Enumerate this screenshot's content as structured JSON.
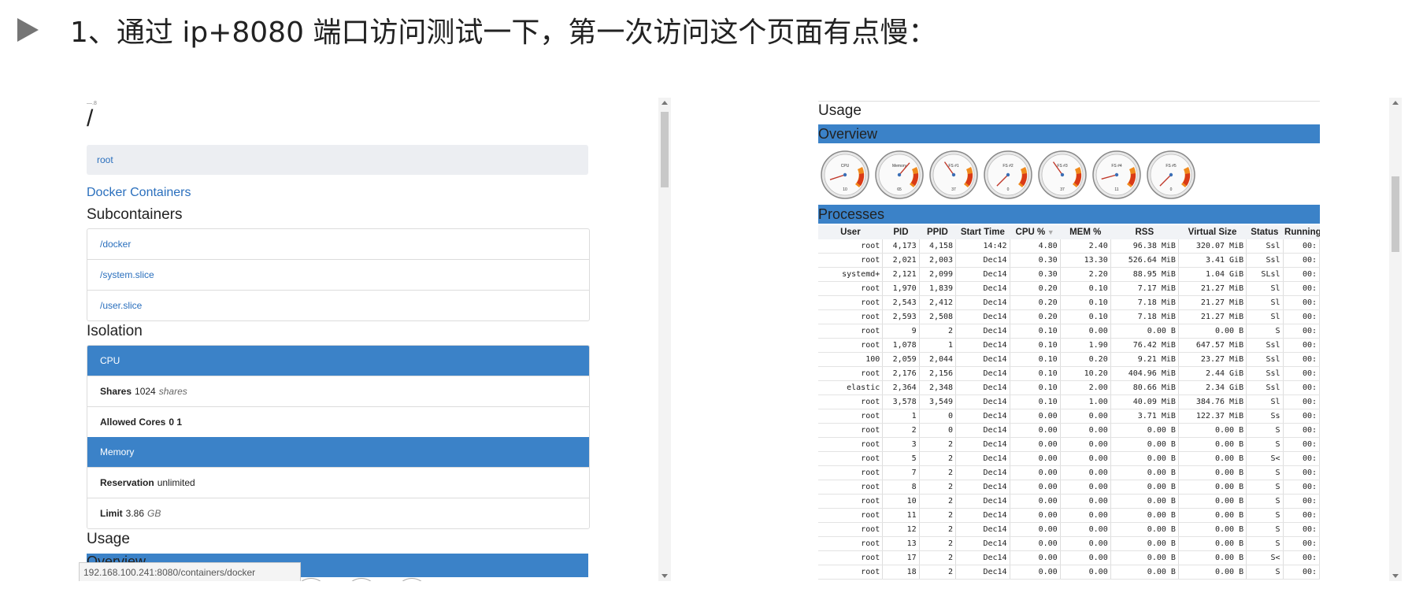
{
  "heading": "1、通过 ip+8080 端口访问测试一下，第一次访问这个页面有点慢：",
  "left": {
    "crumb_small": "—.8",
    "title": "/",
    "root_link": "root",
    "docker_link": "Docker Containers",
    "subcontainers_title": "Subcontainers",
    "subcontainers": [
      "/docker",
      "/system.slice",
      "/user.slice"
    ],
    "isolation_title": "Isolation",
    "cpu_header": "CPU",
    "shares_label": "Shares",
    "shares_value": "1024",
    "shares_unit": "shares",
    "cores_label": "Allowed Cores",
    "cores_value": "0 1",
    "memory_header": "Memory",
    "reservation_label": "Reservation",
    "reservation_value": "unlimited",
    "limit_label": "Limit",
    "limit_value": "3.86",
    "limit_unit": "GB",
    "usage_title": "Usage",
    "overview_title": "Overview",
    "status_url": "192.168.100.241:8080/containers/docker"
  },
  "right": {
    "usage_title": "Usage",
    "overview_title": "Overview",
    "gauges": [
      {
        "label": "CPU",
        "value": "10"
      },
      {
        "label": "Memory",
        "value": "65"
      },
      {
        "label": "FS #1",
        "value": "37"
      },
      {
        "label": "FS #2",
        "value": "0"
      },
      {
        "label": "FS #3",
        "value": "37"
      },
      {
        "label": "FS #4",
        "value": "11"
      },
      {
        "label": "FS #5",
        "value": "0"
      }
    ],
    "processes_title": "Processes",
    "columns": [
      "User",
      "PID",
      "PPID",
      "Start Time",
      "CPU %",
      "MEM %",
      "RSS",
      "Virtual Size",
      "Status",
      "Running"
    ],
    "rows": [
      [
        "root",
        "4,173",
        "4,158",
        "14:42",
        "4.80",
        "2.40",
        "96.38 MiB",
        "320.07 MiB",
        "Ssl",
        "00:"
      ],
      [
        "root",
        "2,021",
        "2,003",
        "Dec14",
        "0.30",
        "13.30",
        "526.64 MiB",
        "3.41 GiB",
        "Ssl",
        "00:"
      ],
      [
        "systemd+",
        "2,121",
        "2,099",
        "Dec14",
        "0.30",
        "2.20",
        "88.95 MiB",
        "1.04 GiB",
        "SLsl",
        "00:"
      ],
      [
        "root",
        "1,970",
        "1,839",
        "Dec14",
        "0.20",
        "0.10",
        "7.17 MiB",
        "21.27 MiB",
        "Sl",
        "00:"
      ],
      [
        "root",
        "2,543",
        "2,412",
        "Dec14",
        "0.20",
        "0.10",
        "7.18 MiB",
        "21.27 MiB",
        "Sl",
        "00:"
      ],
      [
        "root",
        "2,593",
        "2,508",
        "Dec14",
        "0.20",
        "0.10",
        "7.18 MiB",
        "21.27 MiB",
        "Sl",
        "00:"
      ],
      [
        "root",
        "9",
        "2",
        "Dec14",
        "0.10",
        "0.00",
        "0.00 B",
        "0.00 B",
        "S",
        "00:"
      ],
      [
        "root",
        "1,078",
        "1",
        "Dec14",
        "0.10",
        "1.90",
        "76.42 MiB",
        "647.57 MiB",
        "Ssl",
        "00:"
      ],
      [
        "100",
        "2,059",
        "2,044",
        "Dec14",
        "0.10",
        "0.20",
        "9.21 MiB",
        "23.27 MiB",
        "Ssl",
        "00:"
      ],
      [
        "root",
        "2,176",
        "2,156",
        "Dec14",
        "0.10",
        "10.20",
        "404.96 MiB",
        "2.44 GiB",
        "Ssl",
        "00:"
      ],
      [
        "elastic",
        "2,364",
        "2,348",
        "Dec14",
        "0.10",
        "2.00",
        "80.66 MiB",
        "2.34 GiB",
        "Ssl",
        "00:"
      ],
      [
        "root",
        "3,578",
        "3,549",
        "Dec14",
        "0.10",
        "1.00",
        "40.09 MiB",
        "384.76 MiB",
        "Sl",
        "00:"
      ],
      [
        "root",
        "1",
        "0",
        "Dec14",
        "0.00",
        "0.00",
        "3.71 MiB",
        "122.37 MiB",
        "Ss",
        "00:"
      ],
      [
        "root",
        "2",
        "0",
        "Dec14",
        "0.00",
        "0.00",
        "0.00 B",
        "0.00 B",
        "S",
        "00:"
      ],
      [
        "root",
        "3",
        "2",
        "Dec14",
        "0.00",
        "0.00",
        "0.00 B",
        "0.00 B",
        "S",
        "00:"
      ],
      [
        "root",
        "5",
        "2",
        "Dec14",
        "0.00",
        "0.00",
        "0.00 B",
        "0.00 B",
        "S<",
        "00:"
      ],
      [
        "root",
        "7",
        "2",
        "Dec14",
        "0.00",
        "0.00",
        "0.00 B",
        "0.00 B",
        "S",
        "00:"
      ],
      [
        "root",
        "8",
        "2",
        "Dec14",
        "0.00",
        "0.00",
        "0.00 B",
        "0.00 B",
        "S",
        "00:"
      ],
      [
        "root",
        "10",
        "2",
        "Dec14",
        "0.00",
        "0.00",
        "0.00 B",
        "0.00 B",
        "S",
        "00:"
      ],
      [
        "root",
        "11",
        "2",
        "Dec14",
        "0.00",
        "0.00",
        "0.00 B",
        "0.00 B",
        "S",
        "00:"
      ],
      [
        "root",
        "12",
        "2",
        "Dec14",
        "0.00",
        "0.00",
        "0.00 B",
        "0.00 B",
        "S",
        "00:"
      ],
      [
        "root",
        "13",
        "2",
        "Dec14",
        "0.00",
        "0.00",
        "0.00 B",
        "0.00 B",
        "S",
        "00:"
      ],
      [
        "root",
        "17",
        "2",
        "Dec14",
        "0.00",
        "0.00",
        "0.00 B",
        "0.00 B",
        "S<",
        "00:"
      ],
      [
        "root",
        "18",
        "2",
        "Dec14",
        "0.00",
        "0.00",
        "0.00 B",
        "0.00 B",
        "S",
        "00:"
      ]
    ]
  },
  "colors": {
    "accent_blue": "#3b82c8",
    "link_blue": "#2a6fbd",
    "gauge_orange": "#f08a1c",
    "gauge_red": "#d93a17"
  },
  "icons": {
    "bullet": "play-triangle-icon",
    "sort": "sort-down-icon"
  }
}
